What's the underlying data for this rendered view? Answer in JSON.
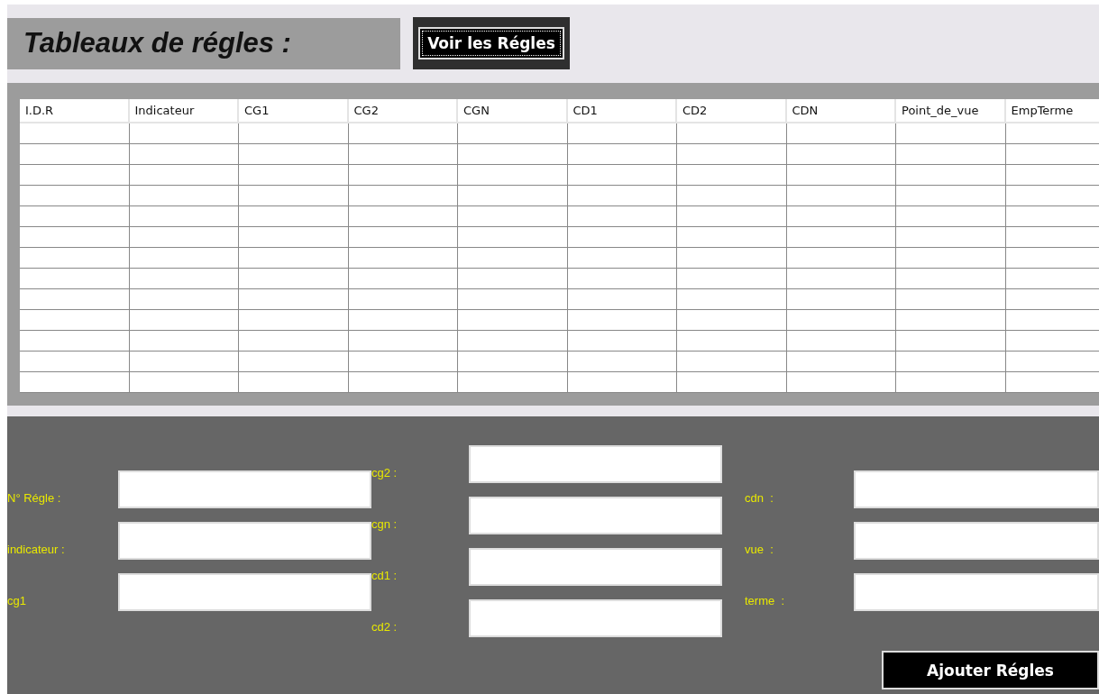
{
  "header": {
    "title": "Tableaux de régles :",
    "view_button": "Voir les Régles"
  },
  "table": {
    "columns": [
      "I.D.R",
      "Indicateur",
      "CG1",
      "CG2",
      "CGN",
      "CD1",
      "CD2",
      "CDN",
      "Point_de_vue",
      "EmpTerme"
    ]
  },
  "form": {
    "columns": [
      [
        {
          "label": "N° Régle :"
        },
        {
          "label": "indicateur :"
        },
        {
          "label": "cg1"
        }
      ],
      [
        {
          "label": "cg2 :"
        },
        {
          "label": "cgn :"
        },
        {
          "label": "cd1 :"
        },
        {
          "label": "cd2 :"
        }
      ],
      [
        {
          "label": "cdn  :"
        },
        {
          "label": "vue  :"
        },
        {
          "label": "terme  :"
        }
      ]
    ],
    "submit_button": "Ajouter Régles"
  }
}
